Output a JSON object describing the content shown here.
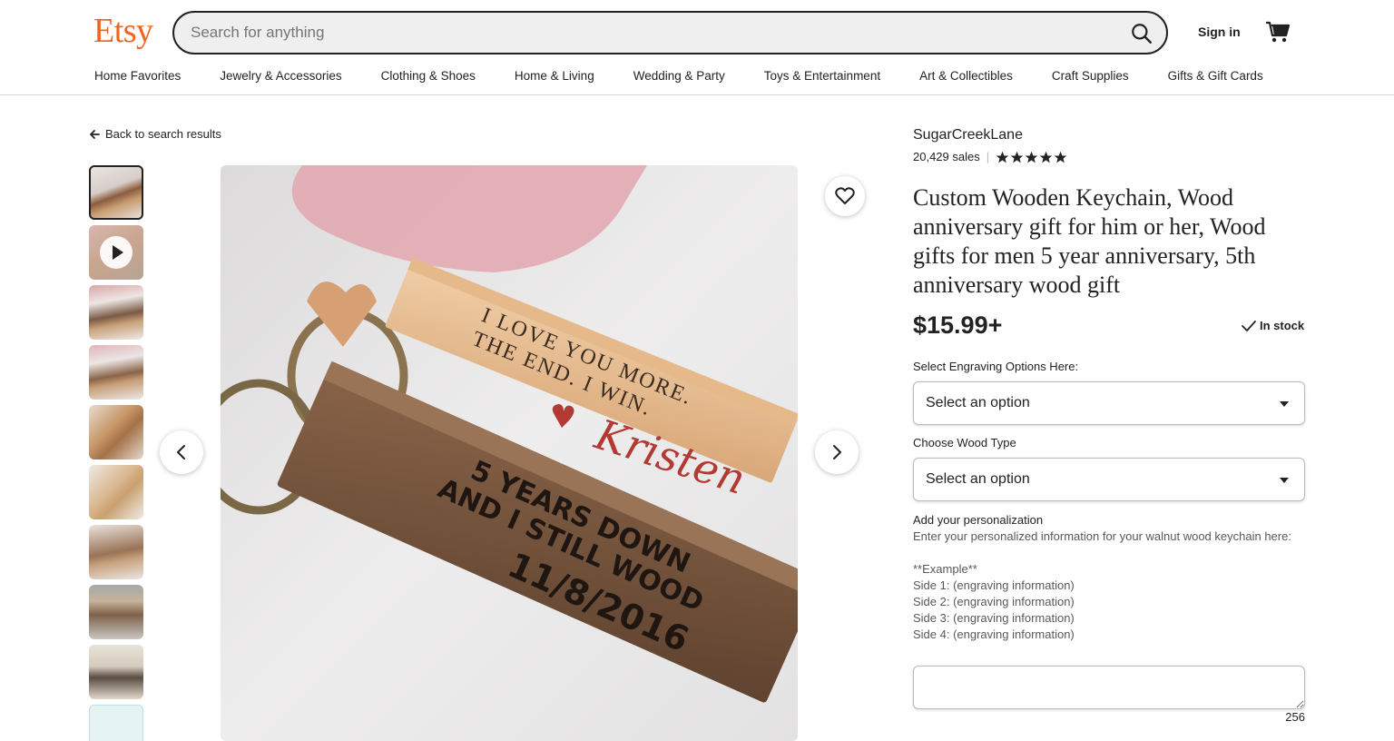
{
  "header": {
    "logo": "Etsy",
    "search_placeholder": "Search for anything",
    "sign_in": "Sign in",
    "nav": [
      "Home Favorites",
      "Jewelry & Accessories",
      "Clothing & Shoes",
      "Home & Living",
      "Wedding & Party",
      "Toys & Entertainment",
      "Art & Collectibles",
      "Craft Supplies",
      "Gifts & Gift Cards"
    ]
  },
  "back_link": "Back to search results",
  "listing": {
    "shop_name": "SugarCreekLane",
    "sales": "20,429 sales",
    "rating_stars": 5,
    "title": "Custom Wooden Keychain, Wood anniversary gift for him or her, Wood gifts for men 5 year anniversary, 5th anniversary wood gift",
    "price": "$15.99+",
    "stock": "In stock",
    "engraving_label": "Select Engraving Options Here:",
    "engraving_value": "Select an option",
    "wood_label": "Choose Wood Type",
    "wood_value": "Select an option",
    "personalization_title": "Add your personalization",
    "personalization_lines": [
      "Enter your personalized information for your walnut wood keychain here:",
      "",
      "**Example**",
      "Side 1: (engraving information)",
      "Side 2: (engraving information)",
      "Side 3: (engraving information)",
      "Side 4: (engraving information)"
    ],
    "char_count": "256"
  },
  "main_image": {
    "engraving_light": [
      "I LOVE YOU MORE.",
      "THE END. I WIN."
    ],
    "engraving_name": "Kristen",
    "engraving_dark": [
      "5 YEARS DOWN",
      "AND I STILL WOOD",
      "11/8/2016"
    ]
  },
  "colors": {
    "brand": "#f1641e",
    "text": "#222222",
    "muted": "#595959"
  }
}
